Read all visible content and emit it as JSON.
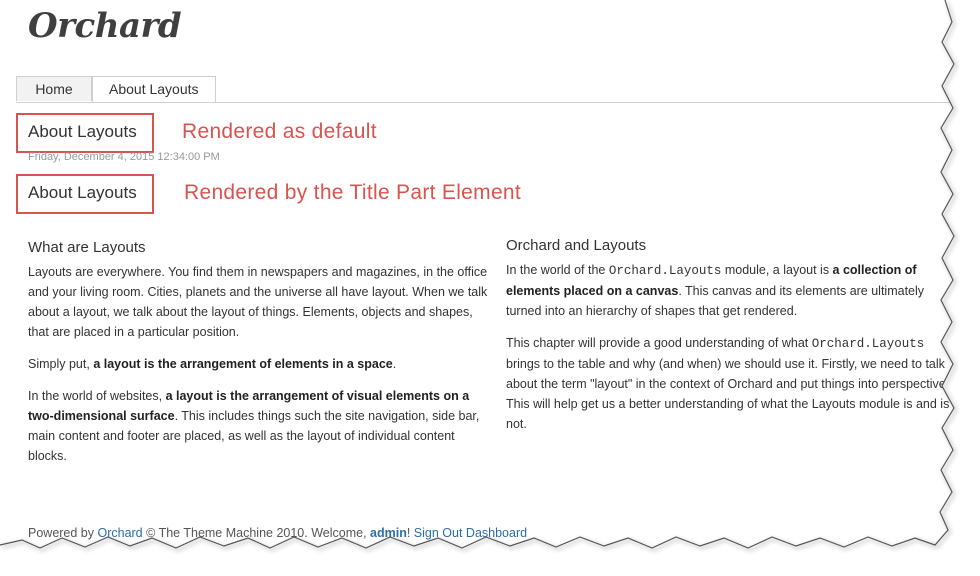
{
  "site": {
    "logo": "Orchard"
  },
  "nav": {
    "tabs": [
      {
        "label": "Home"
      },
      {
        "label": "About Layouts"
      }
    ]
  },
  "annotations": {
    "default_title": "About Layouts",
    "default_label": "Rendered as default",
    "element_title": "About Layouts",
    "element_label": "Rendered by the Title Part Element",
    "color": "#d9534f"
  },
  "meta": {
    "date": "Friday, December 4, 2015 12:34:00 PM"
  },
  "left": {
    "heading": "What are Layouts",
    "p1": "Layouts are everywhere. You find them in newspapers and magazines, in the office and your living room. Cities, planets and the universe all have layout. When we talk about a layout, we talk about the layout of things. Elements, objects and shapes, that are placed in a particular position.",
    "p2_a": "Simply put, ",
    "p2_b": "a layout is the arrangement of elements in a space",
    "p2_c": ".",
    "p3_a": "In the world of websites, ",
    "p3_b": "a layout is the arrangement of visual elements on a two-dimensional surface",
    "p3_c": ". This includes things such the site navigation, side bar, main content and footer are placed, as well as the layout of individual content blocks."
  },
  "right": {
    "heading": "Orchard and Layouts",
    "p1_a": "In the world of the ",
    "p1_code": "Orchard.Layouts",
    "p1_b": " module, a layout is ",
    "p1_c": "a collection of elements placed on a canvas",
    "p1_d": ". This canvas and its elements are ultimately turned into an hierarchy of shapes that get rendered.",
    "p2_a": "This chapter will provide a good understanding of what ",
    "p2_code": "Orchard.Layouts",
    "p2_b": " brings to the table and why (and when) we should use it. Firstly, we need to talk about the term \"layout\" in the context of Orchard and put things into perspective. This will help get us a better understanding of what the Layouts module is and is not."
  },
  "footer": {
    "powered": "Powered by ",
    "orchard_link": "Orchard",
    "copyright": " © The Theme Machine 2010.   Welcome, ",
    "user": "admin",
    "bang": "! ",
    "signout": "Sign Out",
    "dashboard": "Dashboard"
  }
}
